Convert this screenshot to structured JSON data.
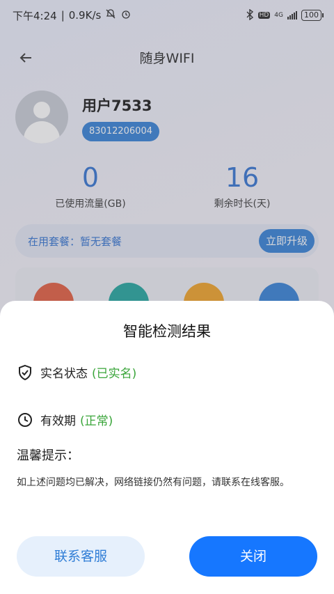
{
  "status_bar": {
    "time": "下午4:24",
    "speed": "0.9K/s",
    "network": "4G",
    "battery": "100"
  },
  "nav": {
    "title": "随身WIFI"
  },
  "user": {
    "name": "用户7533",
    "id": "83012206004"
  },
  "stats": [
    {
      "value": "0",
      "label": "已使用流量(GB)"
    },
    {
      "value": "16",
      "label": "剩余时长(天)"
    }
  ],
  "plan": {
    "text": "在用套餐：暂无套餐",
    "upgrade_label": "立即升级"
  },
  "sheet": {
    "title": "智能检测结果",
    "realname_label": "实名状态",
    "realname_status": "(已实名)",
    "validity_label": "有效期",
    "validity_status": "(正常)",
    "tip_title": "温馨提示：",
    "tip_body": "如上述问题均已解决，网络链接仍然有问题，请联系在线客服。",
    "contact_label": "联系客服",
    "close_label": "关闭"
  },
  "colors": {
    "accent": "#1677ff",
    "ok": "#3aa53a",
    "stat": "#2d6fd0"
  }
}
